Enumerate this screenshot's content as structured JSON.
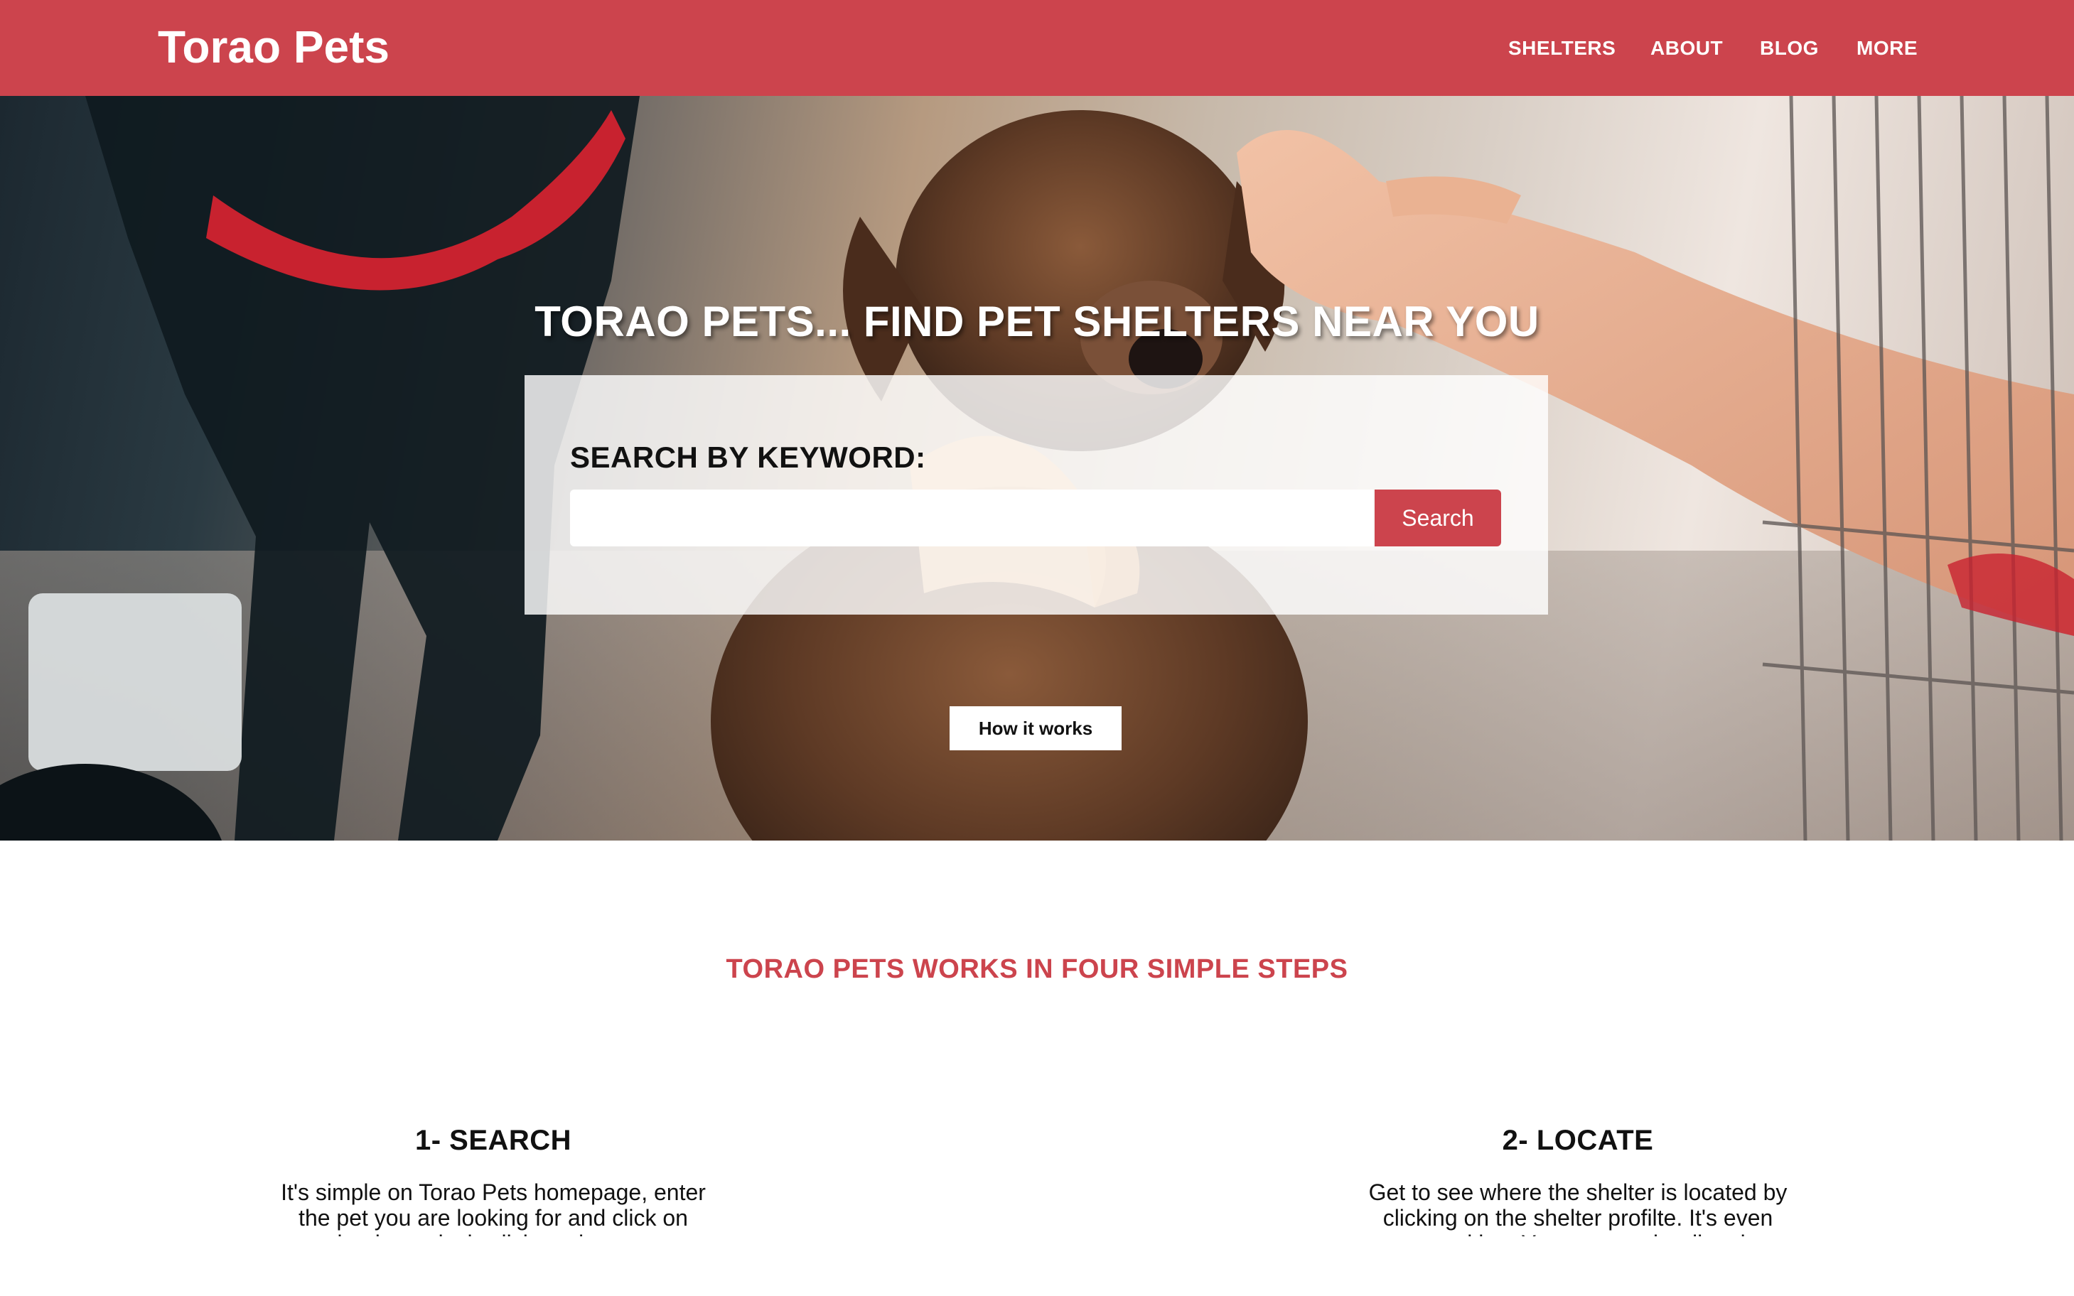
{
  "header": {
    "brand": "Torao Pets",
    "nav": [
      {
        "id": "shelters",
        "label": "SHELTERS"
      },
      {
        "id": "about",
        "label": "ABOUT"
      },
      {
        "id": "blog",
        "label": "BLOG"
      },
      {
        "id": "more",
        "label": "MORE"
      }
    ]
  },
  "hero": {
    "title": "TORAO PETS... FIND PET SHELTERS NEAR YOU",
    "search": {
      "label": "SEARCH BY KEYWORD:",
      "value": "",
      "placeholder": "",
      "button_label": "Search"
    },
    "how_it_works_label": "How it works"
  },
  "steps_section": {
    "title": "TORAO PETS WORKS IN FOUR SIMPLE STEPS",
    "steps": [
      {
        "title": "1- SEARCH",
        "text": "It's simple on Torao Pets homepage, enter the pet you are looking for and click on search, alternatively click on the top menu to"
      },
      {
        "title": "2- LOCATE",
        "text": "Get to see where the shelter is located by clicking on the shelter profilte. It's even more exciting. You can get the directions from"
      }
    ]
  },
  "colors": {
    "brand_red": "#cc444d",
    "header_text": "#ffffff",
    "body_text": "#111111"
  }
}
